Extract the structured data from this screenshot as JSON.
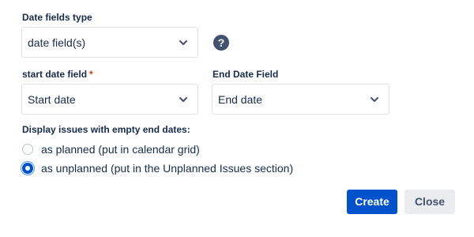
{
  "date_fields_type": {
    "label": "Date fields type",
    "selected": "date field(s)",
    "help_icon": "question-circle-icon"
  },
  "start_date_field": {
    "label": "start date field",
    "required_marker": "*",
    "selected": "Start date"
  },
  "end_date_field": {
    "label": "End Date Field",
    "selected": "End date"
  },
  "empty_end_dates": {
    "label": "Display issues with empty end dates:",
    "options": [
      {
        "label": "as planned (put in calendar grid)",
        "selected": false
      },
      {
        "label": "as unplanned (put in the Unplanned Issues section)",
        "selected": true
      }
    ]
  },
  "actions": {
    "create_label": "Create",
    "close_label": "Close"
  },
  "colors": {
    "primary": "#0052cc",
    "required": "#de350b",
    "text": "#172b4d",
    "help_icon_bg": "#42526e",
    "secondary_button_bg": "#ebecf0"
  }
}
